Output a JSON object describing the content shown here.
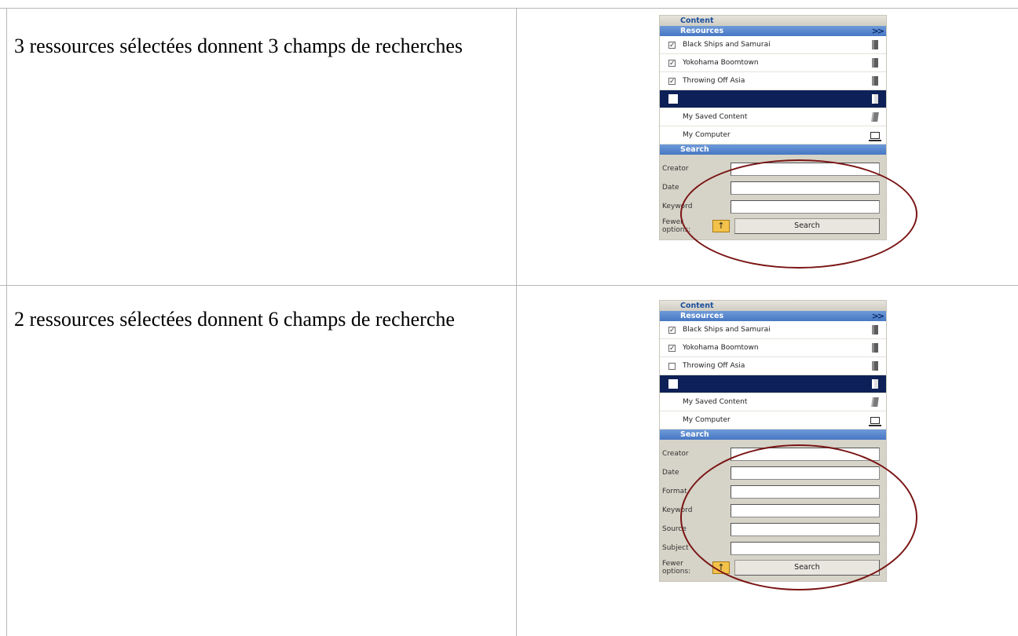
{
  "rows": [
    {
      "caption": "3 ressources sélectées donnent 3 champs de recherches",
      "panel": {
        "content_header": "Content",
        "resources_header": "Resources",
        "resources": [
          {
            "label": "Black Ships and Samurai",
            "checked": true,
            "icon": "book-icon"
          },
          {
            "label": "Yokohama Boomtown",
            "checked": true,
            "icon": "book-icon"
          },
          {
            "label": "Throwing Off Asia",
            "checked": true,
            "icon": "book-icon"
          },
          {
            "label": "",
            "checked": false,
            "selected": true,
            "icon": "book-icon"
          },
          {
            "label": "My Saved Content",
            "icon": "saved-content-icon"
          },
          {
            "label": "My Computer",
            "icon": "computer-icon"
          }
        ],
        "search_header": "Search",
        "fields": [
          "Creator",
          "Date",
          "Keyword"
        ],
        "fewer_options_label": "Fewer options:",
        "search_button": "Search"
      }
    },
    {
      "caption": "2 ressources sélectées donnent 6 champs de recherche",
      "panel": {
        "content_header": "Content",
        "resources_header": "Resources",
        "resources": [
          {
            "label": "Black Ships and Samurai",
            "checked": true,
            "icon": "book-icon"
          },
          {
            "label": "Yokohama Boomtown",
            "checked": true,
            "icon": "book-icon"
          },
          {
            "label": "Throwing Off Asia",
            "checked": false,
            "icon": "book-icon"
          },
          {
            "label": "",
            "checked": false,
            "selected": true,
            "icon": "book-icon"
          },
          {
            "label": "My Saved Content",
            "icon": "saved-content-icon"
          },
          {
            "label": "My Computer",
            "icon": "computer-icon"
          }
        ],
        "search_header": "Search",
        "fields": [
          "Creator",
          "Date",
          "Format",
          "Keyword",
          "Source",
          "Subject"
        ],
        "fewer_options_label": "Fewer options:",
        "search_button": "Search"
      }
    }
  ],
  "colors": {
    "annotation_ellipse": "#7a1414",
    "selected_row": "#0d2057",
    "header_blue": "#4677c4"
  }
}
